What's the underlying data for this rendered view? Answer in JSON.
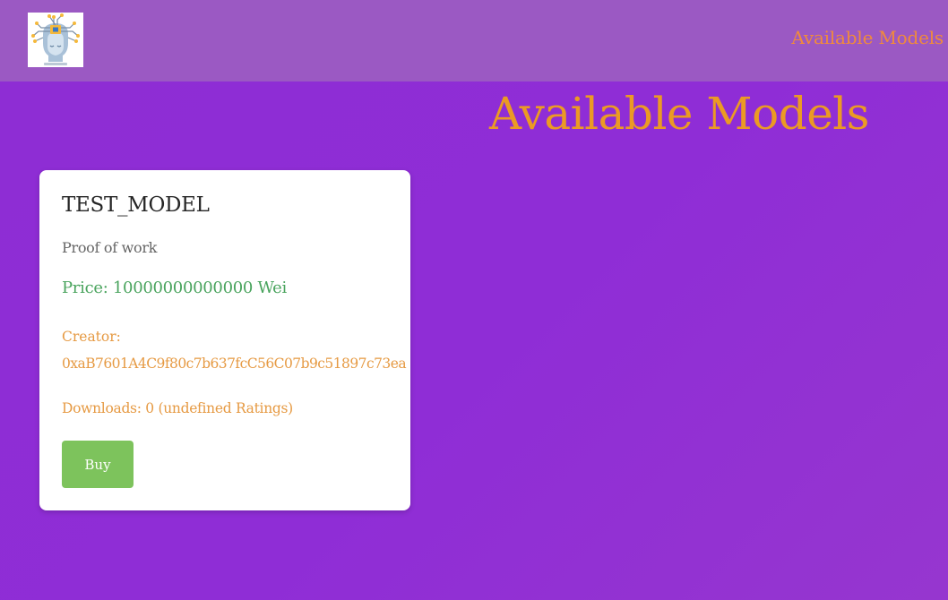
{
  "nav": {
    "logo_icon": "ai-head-circuit-icon",
    "link_label": "Available Models"
  },
  "page": {
    "title": "Available Models"
  },
  "models": [
    {
      "name": "TEST_MODEL",
      "description": "Proof of work",
      "price": "Price: 10000000000000 Wei",
      "creator_label": "Creator:",
      "creator_address": "0xaB7601A4C9f80c7b637fcC56C07b9c51897c73ea",
      "downloads": "Downloads: 0 (undefined Ratings)",
      "buy_label": "Buy"
    }
  ],
  "colors": {
    "background": "#8e2dd4",
    "navbar": "#9b59c3",
    "accent_orange": "#eb9a24",
    "price_green": "#4aa45e",
    "button_green": "#7dc35c"
  }
}
